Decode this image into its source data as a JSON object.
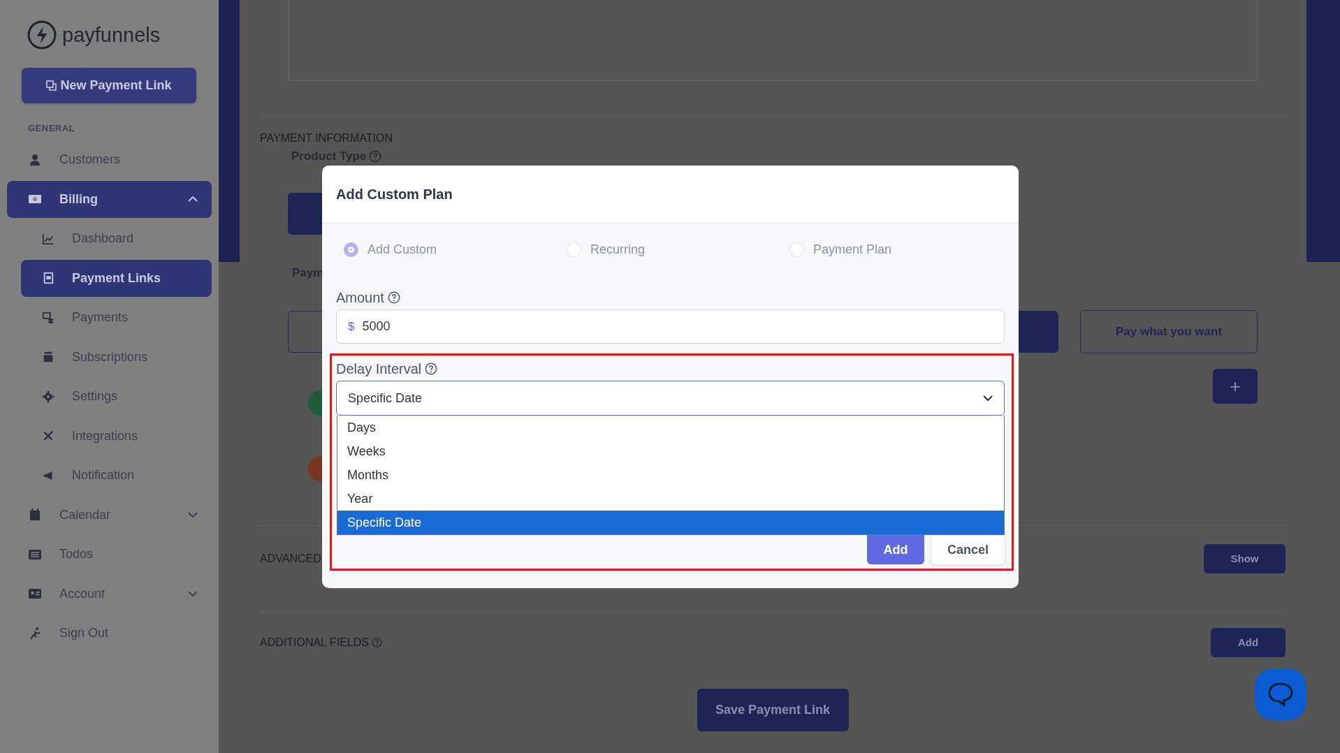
{
  "logo": {
    "text": "payfunnels"
  },
  "new_button": {
    "label": "New Payment Link"
  },
  "sidebar": {
    "section": "GENERAL",
    "items": [
      {
        "label": "Customers",
        "kind": "link",
        "selected": false
      },
      {
        "label": "Billing",
        "kind": "group",
        "selected": true,
        "expanded": true,
        "children": [
          {
            "label": "Dashboard",
            "selected": false
          },
          {
            "label": "Payment Links",
            "selected": true
          },
          {
            "label": "Payments",
            "selected": false
          },
          {
            "label": "Subscriptions",
            "selected": false
          },
          {
            "label": "Settings",
            "selected": false
          },
          {
            "label": "Integrations",
            "selected": false
          },
          {
            "label": "Notification",
            "selected": false
          }
        ]
      },
      {
        "label": "Calendar",
        "kind": "group",
        "selected": false,
        "expanded": false
      },
      {
        "label": "Todos",
        "kind": "link",
        "selected": false
      },
      {
        "label": "Account",
        "kind": "group",
        "selected": false,
        "expanded": false
      },
      {
        "label": "Sign Out",
        "kind": "link",
        "selected": false
      }
    ]
  },
  "page": {
    "section_title": "PAYMENT INFORMATION",
    "product_type_label": "Product Type",
    "payment_label": "Paym",
    "pay_what_button": "Pay what you want",
    "plus_button": "+",
    "advanced_title": "ADVANCED",
    "advanced_button": "Show",
    "additional_title": "ADDITIONAL FIELDS",
    "additional_button": "Add",
    "save_button": "Save Payment Link"
  },
  "modal": {
    "title": "Add Custom Plan",
    "plan_types": [
      {
        "label": "Add Custom",
        "selected": true
      },
      {
        "label": "Recurring",
        "selected": false
      },
      {
        "label": "Payment Plan",
        "selected": false
      }
    ],
    "amount": {
      "label": "Amount",
      "prefix": "$",
      "value": "5000"
    },
    "delay_interval": {
      "label": "Delay Interval",
      "value": "Specific Date",
      "options": [
        {
          "label": "Days",
          "selected": false
        },
        {
          "label": "Weeks",
          "selected": false
        },
        {
          "label": "Months",
          "selected": false
        },
        {
          "label": "Year",
          "selected": false
        },
        {
          "label": "Specific Date",
          "selected": true
        }
      ]
    },
    "add_button": "Add",
    "cancel_button": "Cancel"
  }
}
